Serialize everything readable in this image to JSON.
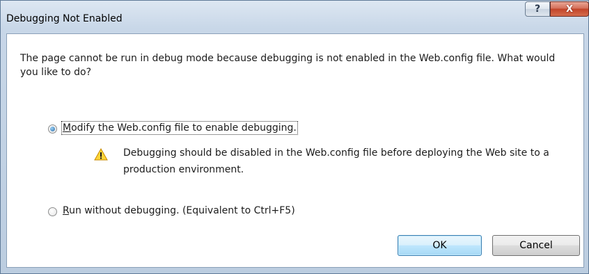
{
  "dialog": {
    "title": "Debugging Not Enabled",
    "help_glyph": "?",
    "close_glyph": "X"
  },
  "message": "The page cannot be run in debug mode because debugging is not enabled in the Web.config file. What would you like to do?",
  "options": {
    "modify": {
      "accel": "M",
      "label_rest": "odify the Web.config file to enable debugging.",
      "checked": true
    },
    "warning": "Debugging should be disabled in the Web.config file before deploying the Web site to a production environment.",
    "run": {
      "accel": "R",
      "label_rest": "un without debugging. (Equivalent to Ctrl+F5)",
      "checked": false
    }
  },
  "buttons": {
    "ok": "OK",
    "cancel": "Cancel"
  }
}
